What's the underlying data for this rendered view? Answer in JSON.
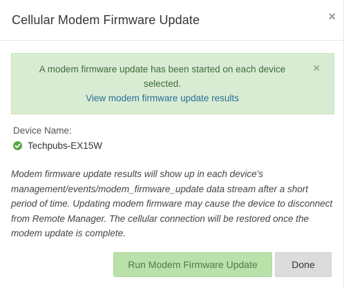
{
  "dialog": {
    "title": "Cellular Modem Firmware Update",
    "close_glyph": "×"
  },
  "alert": {
    "message": "A modem firmware update has been started on each device selected.",
    "link_text": "View modem firmware update results",
    "close_glyph": "×",
    "background": "#d8ecd3"
  },
  "device": {
    "label": "Device Name:",
    "name": "Techpubs-EX15W",
    "status_icon": "check-circle-icon",
    "status_color": "#5aa84a"
  },
  "note": "Modem firmware update results will show up in each device's management/events/modem_firmware_update data stream after a short period of time. Updating modem firmware may cause the device to disconnect from Remote Manager. The cellular connection will be restored once the modem update is complete.",
  "buttons": {
    "run_label": "Run Modem Firmware Update",
    "run_enabled": false,
    "done_label": "Done"
  }
}
